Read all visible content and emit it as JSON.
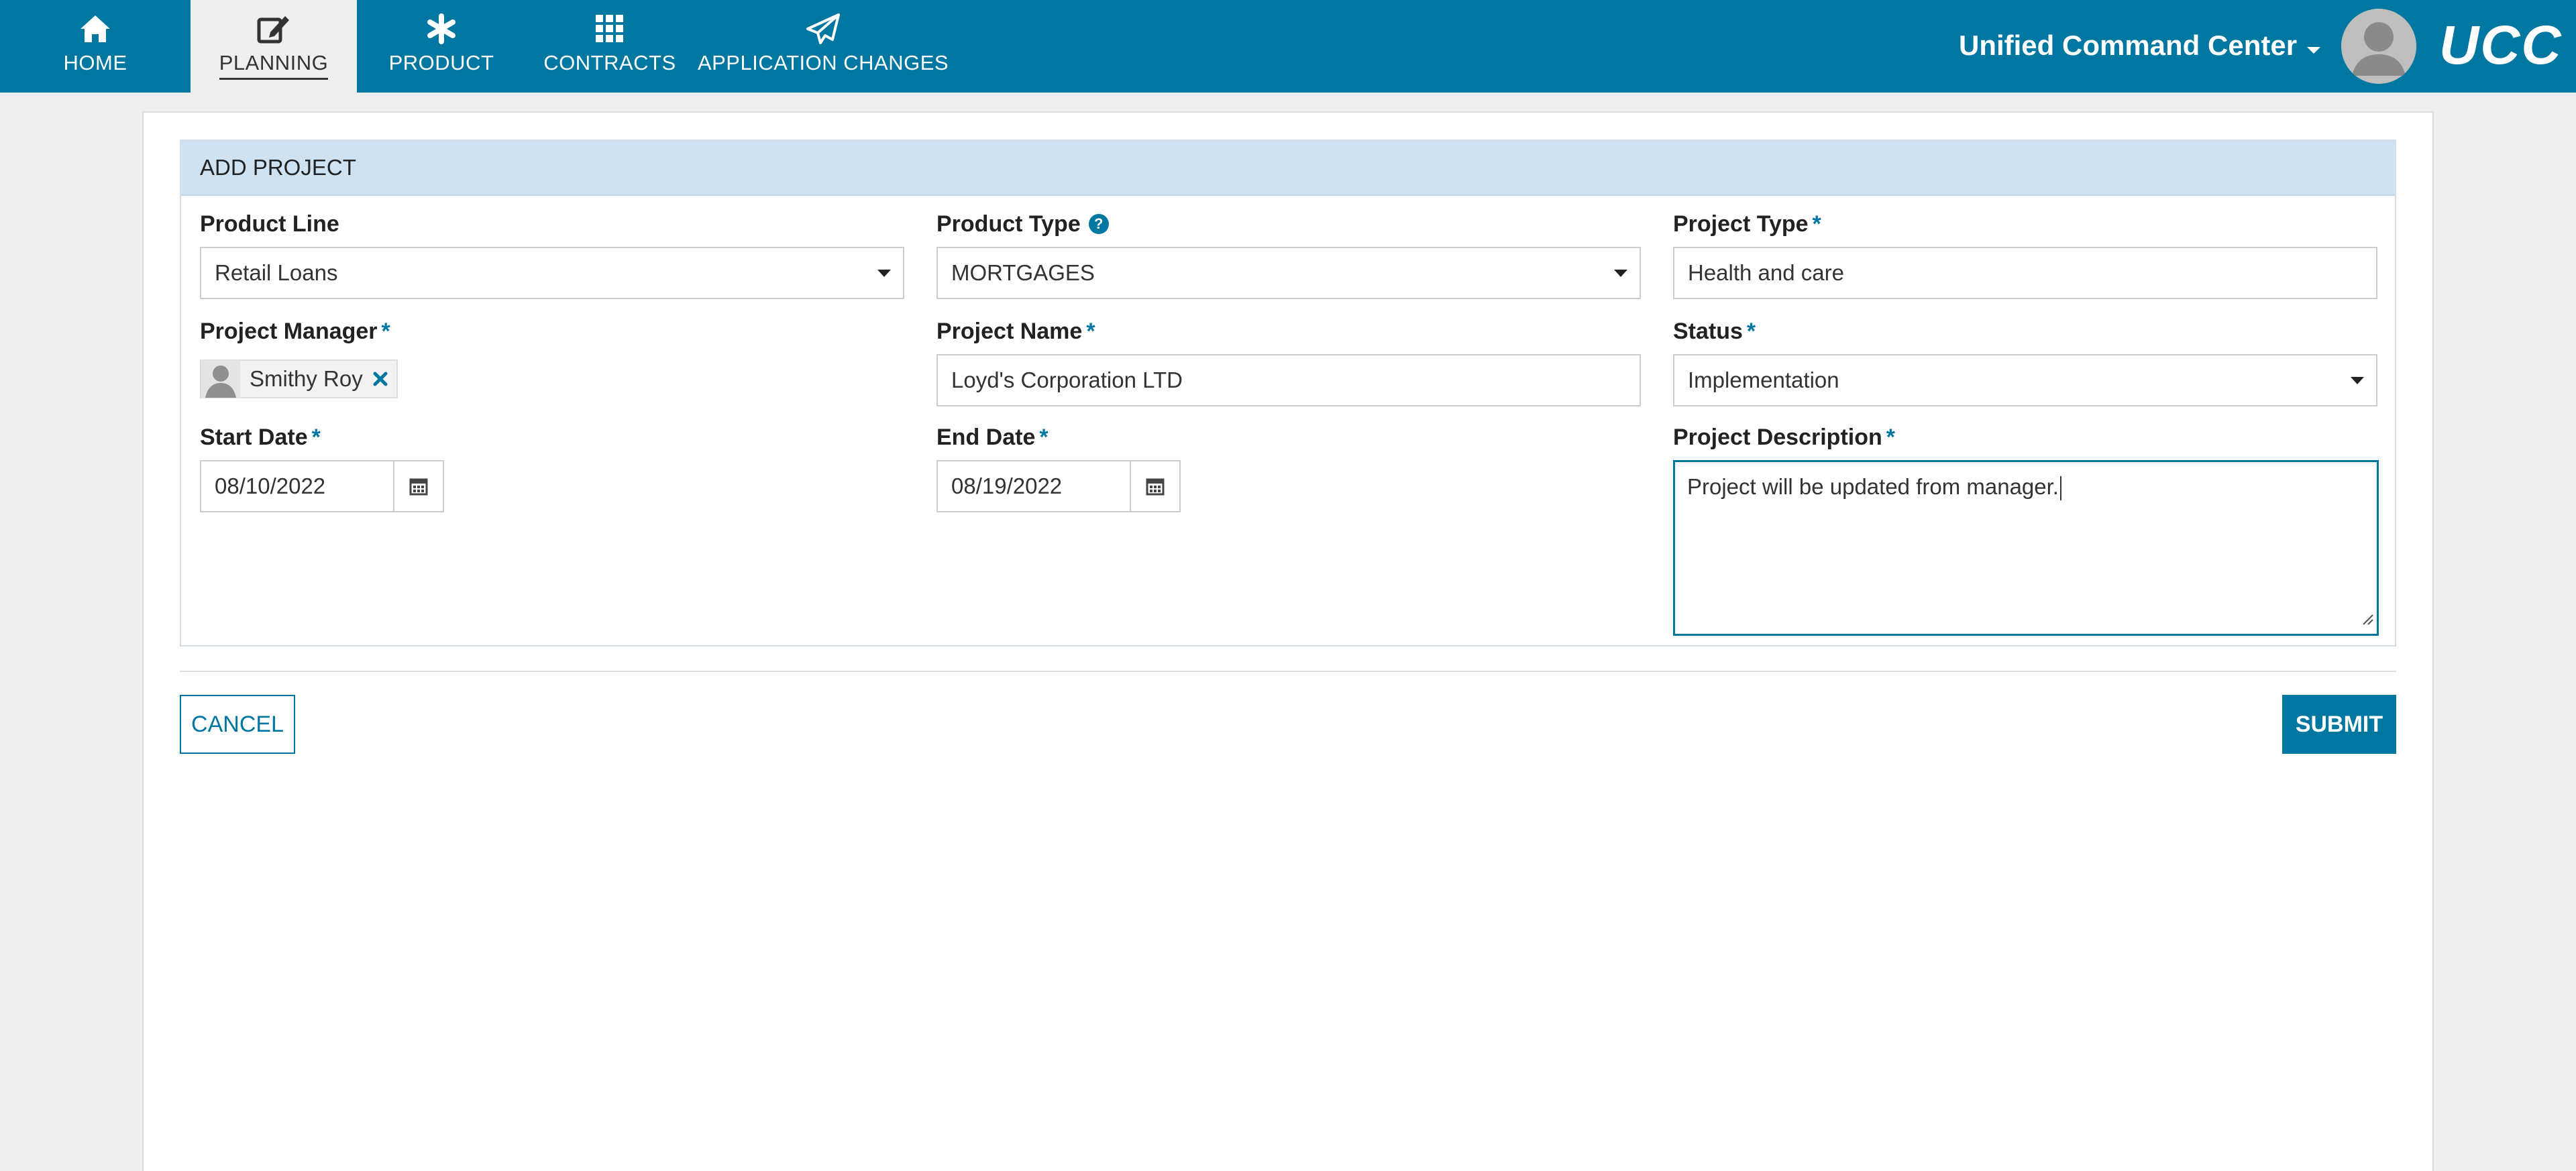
{
  "nav": {
    "items": [
      {
        "label": "HOME",
        "icon": "home-icon",
        "active": false
      },
      {
        "label": "PLANNING",
        "icon": "edit-icon",
        "active": true
      },
      {
        "label": "PRODUCT",
        "icon": "asterisk-icon",
        "active": false
      },
      {
        "label": "CONTRACTS",
        "icon": "grid-icon",
        "active": false
      },
      {
        "label": "APPLICATION CHANGES",
        "icon": "paper-plane-icon",
        "active": false
      }
    ]
  },
  "header": {
    "app_menu_label": "Unified Command Center",
    "logo_text": "UCC"
  },
  "form": {
    "title": "ADD PROJECT",
    "product_line": {
      "label": "Product Line",
      "value": "Retail Loans"
    },
    "product_type": {
      "label": "Product Type",
      "value": "MORTGAGES"
    },
    "project_type": {
      "label": "Project Type",
      "value": "Health and care"
    },
    "project_manager": {
      "label": "Project Manager",
      "value": "Smithy Roy"
    },
    "project_name": {
      "label": "Project Name",
      "value": "Loyd's Corporation LTD"
    },
    "status": {
      "label": "Status",
      "value": "Implementation"
    },
    "start_date": {
      "label": "Start Date",
      "value": "08/10/2022"
    },
    "end_date": {
      "label": "End Date",
      "value": "08/19/2022"
    },
    "project_description": {
      "label": "Project Description",
      "value": "Project will be updated from manager."
    },
    "required_marker": "*"
  },
  "actions": {
    "cancel_label": "CANCEL",
    "submit_label": "SUBMIT"
  },
  "colors": {
    "accent": "#0077a0",
    "header_band": "#cfe2f1",
    "background": "#efefef"
  }
}
